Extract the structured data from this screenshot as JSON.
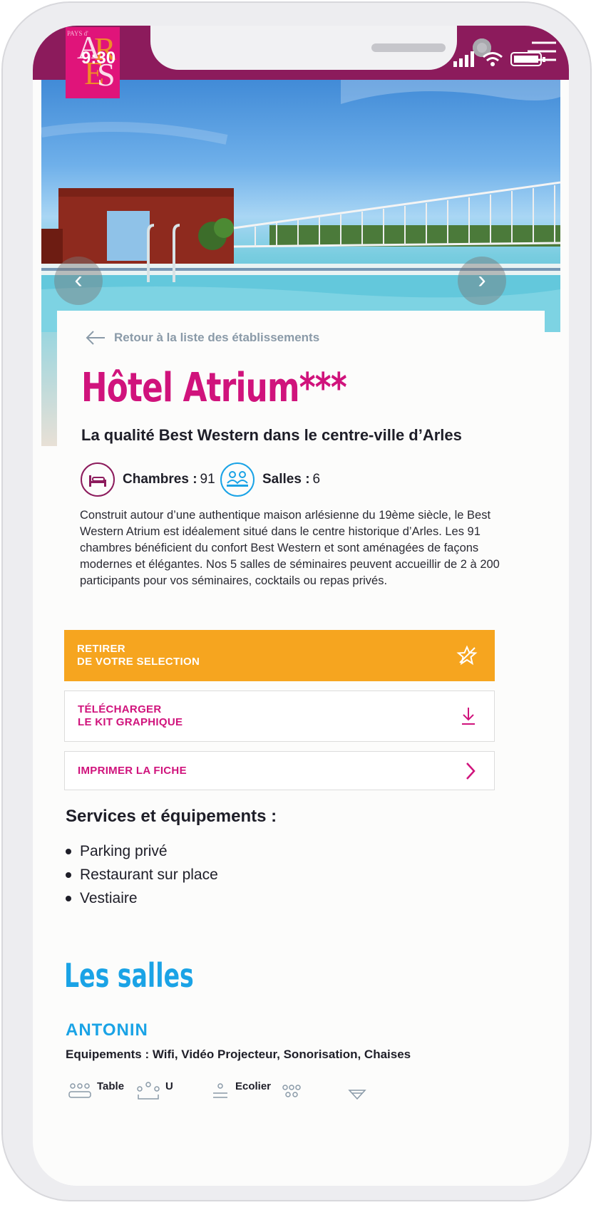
{
  "status_bar": {
    "time": "9:30"
  },
  "logo": {
    "small_text": "PAYS d'",
    "letters": "ARLES"
  },
  "hero": {
    "prev_icon": "chevron-left-icon",
    "next_icon": "chevron-right-icon"
  },
  "back_link": {
    "label": "Retour à la liste des établissements"
  },
  "hotel": {
    "name": "Hôtel Atrium***",
    "tagline": "La qualité Best Western dans le centre-ville d’Arles",
    "chambres_label": "Chambres :",
    "chambres_value": "91",
    "salles_label": "Salles :",
    "salles_value": "6",
    "description": "Construit autour d’une authentique maison arlésienne du 19ème siècle, le Best Western Atrium est idéalement situé dans le centre historique d’Arles. Les 91 chambres bénéficient du confort Best Western et sont aménagées de façons modernes et élégantes. Nos 5 salles de séminaires peuvent accueillir de 2 à 200 participants pour vos séminaires, cocktails ou repas privés."
  },
  "actions": {
    "remove_line1": "RETIRER",
    "remove_line2": "DE VOTRE SELECTION",
    "download_line1": "TÉLÉCHARGER",
    "download_line2": "LE KIT GRAPHIQUE",
    "print": "IMPRIMER LA FICHE"
  },
  "services": {
    "title": "Services et équipements :",
    "items": [
      "Parking privé",
      "Restaurant sur place",
      "Vestiaire"
    ]
  },
  "rooms": {
    "section_title": "Les salles",
    "first": {
      "name": "ANTONIN",
      "equipment": "Equipements : Wifi, Vidéo Projecteur, Sonorisation, Chaises",
      "layouts": [
        "Table",
        "U",
        "Ecolier"
      ]
    }
  },
  "colors": {
    "brand_magenta": "#d0137c",
    "status_bar": "#8c1b5c",
    "accent_orange": "#f6a51f",
    "accent_blue": "#1aa3e6"
  }
}
